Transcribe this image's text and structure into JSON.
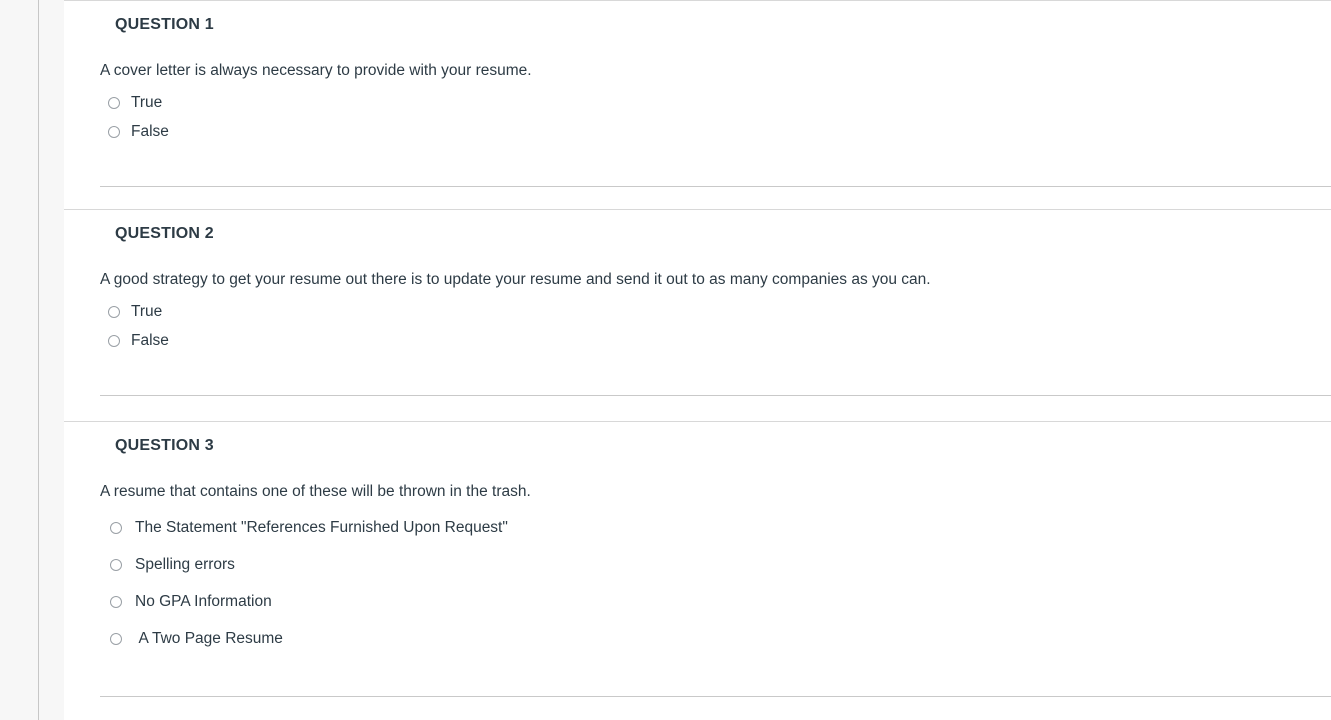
{
  "theme": {
    "page_background": "#ffffff",
    "rail_background": "#f7f7f7",
    "rail_border": "#c7c7c7",
    "section_border": "#d8d8d8",
    "inner_divider": "#c9c9c9",
    "text_color": "#2d3b45",
    "radio_border": "#9aa0a6"
  },
  "quiz": {
    "questions": [
      {
        "header": "QUESTION 1",
        "prompt": "A cover letter is always necessary to provide with your resume.",
        "layout": "compact",
        "options": [
          {
            "label": "True",
            "selected": false
          },
          {
            "label": "False",
            "selected": false
          }
        ]
      },
      {
        "header": "QUESTION 2",
        "prompt": "A good strategy to get your resume out there is to update your resume and send it out to as many companies as you can.",
        "layout": "compact",
        "options": [
          {
            "label": "True",
            "selected": false
          },
          {
            "label": "False",
            "selected": false
          }
        ]
      },
      {
        "header": "QUESTION 3",
        "prompt": "A resume that contains one of these will be thrown in the trash.",
        "layout": "spaced",
        "options": [
          {
            "label": "The Statement \"References Furnished Upon Request\"",
            "selected": false
          },
          {
            "label": "Spelling errors",
            "selected": false
          },
          {
            "label": "No GPA Information",
            "selected": false
          },
          {
            "label": " A Two Page Resume",
            "selected": false
          }
        ]
      }
    ]
  }
}
